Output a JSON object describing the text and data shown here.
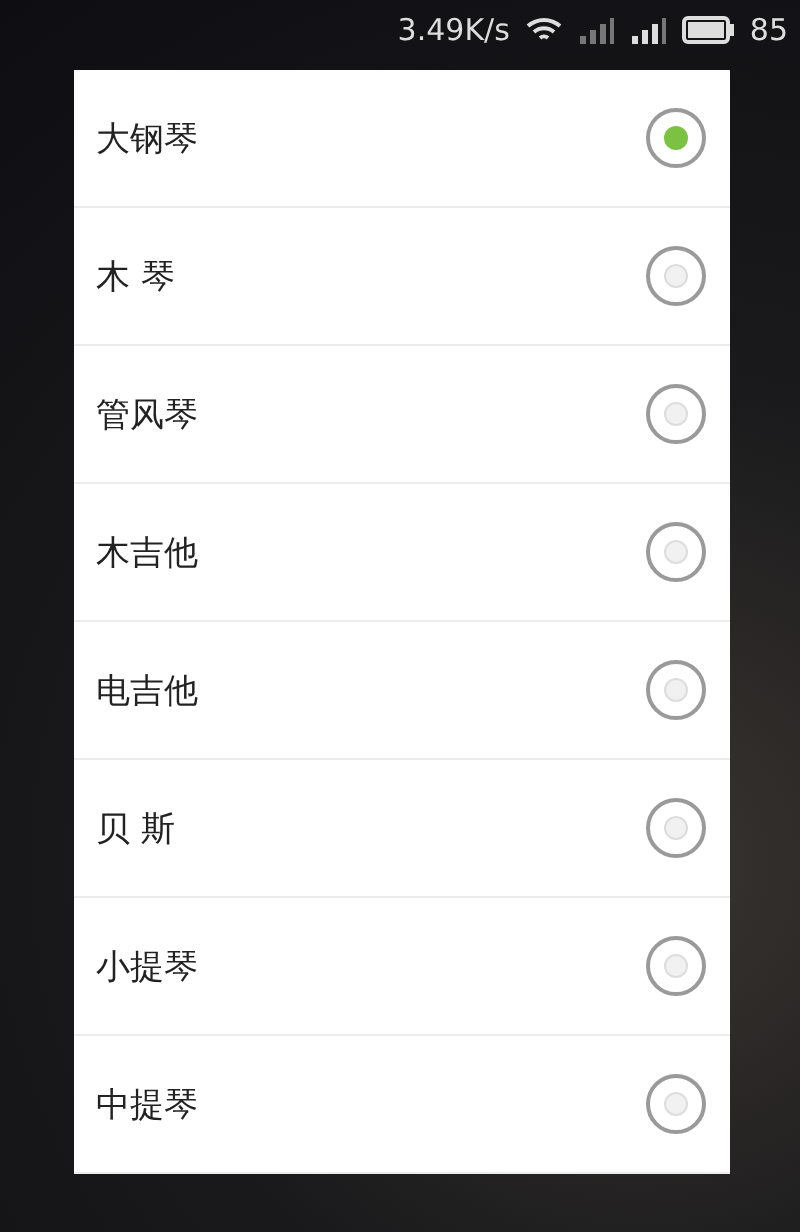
{
  "status_bar": {
    "net_speed": "3.49K/s",
    "battery": "85"
  },
  "options": [
    {
      "label": "大钢琴",
      "selected": true
    },
    {
      "label": "木 琴",
      "selected": false
    },
    {
      "label": "管风琴",
      "selected": false
    },
    {
      "label": "木吉他",
      "selected": false
    },
    {
      "label": "电吉他",
      "selected": false
    },
    {
      "label": "贝 斯",
      "selected": false
    },
    {
      "label": "小提琴",
      "selected": false
    },
    {
      "label": "中提琴",
      "selected": false
    }
  ]
}
